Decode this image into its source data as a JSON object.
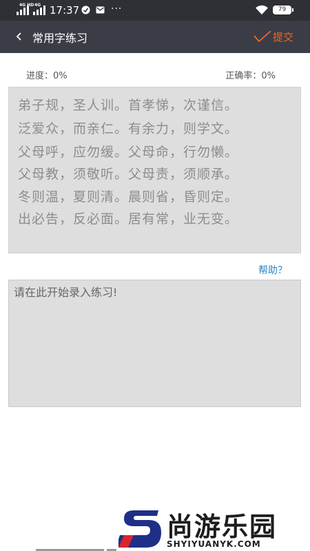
{
  "status_bar": {
    "network_top": "4G HD",
    "network_bottom": "4G",
    "time": "17:37",
    "dots": "···",
    "battery": "79"
  },
  "header": {
    "title": "常用字练习",
    "submit_label": "提交",
    "accent": "#e9682b"
  },
  "stats": {
    "progress": "进度：0%",
    "accuracy": "正确率：0%"
  },
  "reference_lines": [
    "弟子规，圣人训。首孝悌，次谨信。",
    "泛爱众，而亲仁。有余力，则学文。",
    "父母呼，应勿缓。父母命，行勿懒。",
    "父母教，须敬听。父母责，须顺承。",
    "冬则温，夏则清。晨则省，昏则定。",
    "出必告，反必面。居有常，业无变。"
  ],
  "help_label": "帮助？",
  "input": {
    "placeholder": "请在此开始录入练习!"
  },
  "watermark": {
    "text": "尚游乐园",
    "url": "SHYIYUANYK.COM"
  }
}
